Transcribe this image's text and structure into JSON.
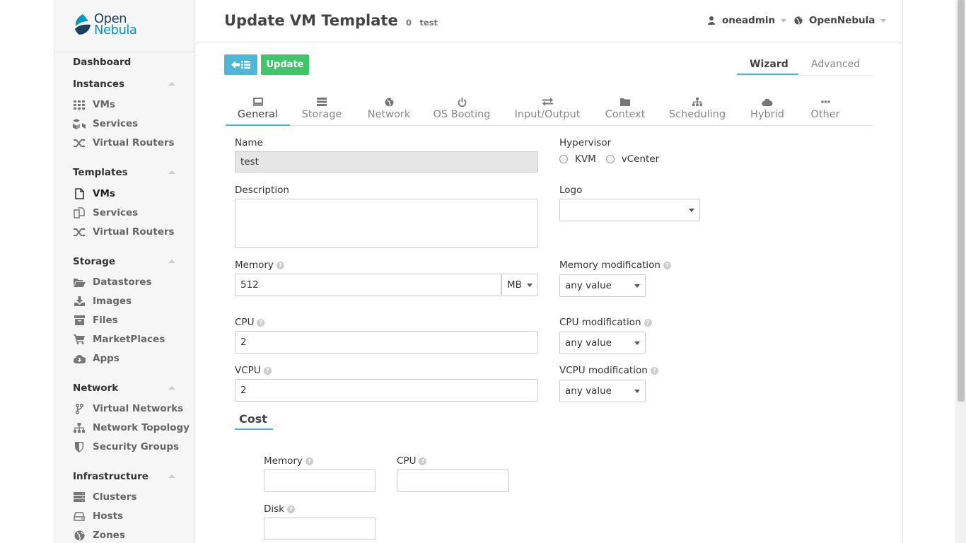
{
  "brand": {
    "line1": "Open",
    "line2": "Nebula"
  },
  "sidebar": {
    "dashboard": "Dashboard",
    "groups": [
      {
        "title": "Instances",
        "items": [
          "VMs",
          "Services",
          "Virtual Routers"
        ]
      },
      {
        "title": "Templates",
        "items": [
          "VMs",
          "Services",
          "Virtual Routers"
        ]
      },
      {
        "title": "Storage",
        "items": [
          "Datastores",
          "Images",
          "Files",
          "MarketPlaces",
          "Apps"
        ]
      },
      {
        "title": "Network",
        "items": [
          "Virtual Networks",
          "Network Topology",
          "Security Groups"
        ]
      },
      {
        "title": "Infrastructure",
        "items": [
          "Clusters",
          "Hosts",
          "Zones"
        ]
      }
    ]
  },
  "header": {
    "title": "Update VM Template",
    "id": "0",
    "name": "test",
    "user": "oneadmin",
    "zone": "OpenNebula"
  },
  "toolbar": {
    "update_label": "Update"
  },
  "mode_tabs": {
    "wizard": "Wizard",
    "advanced": "Advanced"
  },
  "tabs": [
    "General",
    "Storage",
    "Network",
    "OS Booting",
    "Input/Output",
    "Context",
    "Scheduling",
    "Hybrid",
    "Other"
  ],
  "form": {
    "name_label": "Name",
    "name_value": "test",
    "description_label": "Description",
    "description_value": "",
    "hypervisor_label": "Hypervisor",
    "hypervisor_options": [
      "KVM",
      "vCenter"
    ],
    "logo_label": "Logo",
    "logo_value": "",
    "memory_label": "Memory",
    "memory_value": "512",
    "memory_unit": "MB",
    "memory_mod_label": "Memory modification",
    "memory_mod_value": "any value",
    "cpu_label": "CPU",
    "cpu_value": "2",
    "cpu_mod_label": "CPU modification",
    "cpu_mod_value": "any value",
    "vcpu_label": "VCPU",
    "vcpu_value": "2",
    "vcpu_mod_label": "VCPU modification",
    "vcpu_mod_value": "any value"
  },
  "cost": {
    "title": "Cost",
    "memory_label": "Memory",
    "memory_value": "",
    "cpu_label": "CPU",
    "cpu_value": "",
    "disk_label": "Disk",
    "disk_value": ""
  },
  "colors": {
    "accent": "#4cb8d8",
    "update": "#41c56a",
    "brand_dark": "#1c3e5f",
    "brand_light": "#0098c3"
  }
}
